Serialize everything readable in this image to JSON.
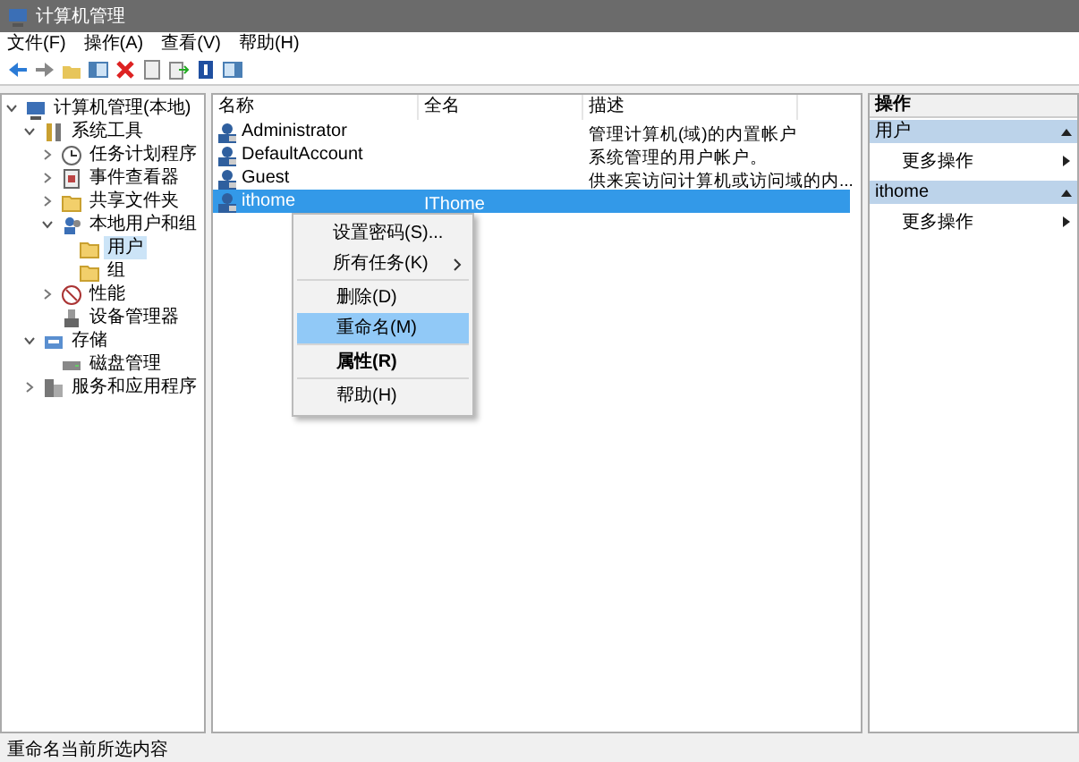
{
  "window": {
    "title": "计算机管理"
  },
  "menu_bar": [
    "文件(F)",
    "操作(A)",
    "查看(V)",
    "帮助(H)"
  ],
  "tree": [
    {
      "label": "计算机管理(本地)",
      "selected": false,
      "expanded": true,
      "children": [
        {
          "label": "系统工具",
          "selected": false,
          "expanded": true,
          "children": [
            {
              "label": "任务计划程序",
              "selected": false,
              "expanded": false
            },
            {
              "label": "事件查看器",
              "selected": false,
              "expanded": false
            },
            {
              "label": "共享文件夹",
              "selected": false,
              "expanded": false
            },
            {
              "label": "本地用户和组",
              "selected": false,
              "expanded": true,
              "children": [
                {
                  "label": "用户",
                  "selected": true
                },
                {
                  "label": "组",
                  "selected": false
                }
              ]
            },
            {
              "label": "性能",
              "selected": false,
              "expanded": false
            },
            {
              "label": "设备管理器",
              "selected": false
            }
          ]
        },
        {
          "label": "存储",
          "selected": false,
          "expanded": true,
          "children": [
            {
              "label": "磁盘管理",
              "selected": false
            }
          ]
        },
        {
          "label": "服务和应用程序",
          "selected": false,
          "expanded": false
        }
      ]
    }
  ],
  "list": {
    "columns": [
      "名称",
      "全名",
      "描述"
    ],
    "rows": [
      {
        "name": "Administrator",
        "description": "管理计算机(域)的内置帐户",
        "selected": false
      },
      {
        "name": "DefaultAccount",
        "description": "系统管理的用户帐户。",
        "selected": false
      },
      {
        "name": "Guest",
        "description": "供来宾访问计算机或访问域的内...",
        "selected": false
      },
      {
        "name": "ithome",
        "full_name": "IThome",
        "selected": true
      }
    ]
  },
  "context_menu": [
    [
      {
        "label": "设置密码(S)...",
        "selected": false,
        "bold": false,
        "submenu": false
      },
      {
        "label": "所有任务(K)",
        "selected": false,
        "bold": false,
        "submenu": true
      }
    ],
    [
      {
        "label": "删除(D)",
        "selected": false,
        "bold": false,
        "submenu": false
      },
      {
        "label": "重命名(M)",
        "selected": true,
        "bold": false,
        "submenu": false
      }
    ],
    [
      {
        "label": "属性(R)",
        "selected": false,
        "bold": true,
        "submenu": false
      }
    ],
    [
      {
        "label": "帮助(H)",
        "selected": false,
        "bold": false,
        "submenu": false
      }
    ]
  ],
  "actions": {
    "title": "操作",
    "sections": [
      {
        "title": "用户",
        "items": [
          "更多操作"
        ]
      },
      {
        "title": "ithome",
        "items": [
          "更多操作"
        ]
      }
    ]
  },
  "status_bar": "重命名当前所选内容"
}
